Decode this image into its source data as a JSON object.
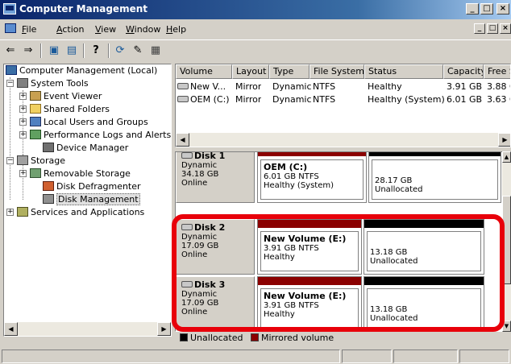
{
  "window": {
    "title": "Computer Management",
    "controls": [
      "_",
      "□",
      "×"
    ],
    "mdi_controls": [
      "_",
      "□",
      "×"
    ]
  },
  "menu": {
    "items": [
      {
        "label": "File",
        "ul": "F",
        "rest": "ile"
      },
      {
        "label": "Action",
        "ul": "A",
        "rest": "ction"
      },
      {
        "label": "View",
        "ul": "V",
        "rest": "iew"
      },
      {
        "label": "Window",
        "ul": "W",
        "rest": "indow"
      },
      {
        "label": "Help",
        "ul": "H",
        "rest": "elp"
      }
    ]
  },
  "toolbar": {
    "back": "⇐",
    "forward": "⇒",
    "up": "▣",
    "show_hide": "▤",
    "help": "?",
    "refresh": "⟳",
    "export": "✎",
    "properties": "▦"
  },
  "tree": {
    "items": [
      {
        "label": "Computer Management (Local)",
        "icon": "computer-icon"
      },
      {
        "label": "System Tools",
        "icon": "tools-icon"
      },
      {
        "label": "Event Viewer",
        "icon": "event-viewer-icon"
      },
      {
        "label": "Shared Folders",
        "icon": "folder-icon"
      },
      {
        "label": "Local Users and Groups",
        "icon": "users-icon"
      },
      {
        "label": "Performance Logs and Alerts",
        "icon": "performance-icon"
      },
      {
        "label": "Device Manager",
        "icon": "device-manager-icon"
      },
      {
        "label": "Storage",
        "icon": "storage-icon"
      },
      {
        "label": "Removable Storage",
        "icon": "removable-storage-icon"
      },
      {
        "label": "Disk Defragmenter",
        "icon": "defrag-icon"
      },
      {
        "label": "Disk Management",
        "icon": "disk-management-icon"
      },
      {
        "label": "Services and Applications",
        "icon": "services-icon"
      }
    ]
  },
  "volumes": {
    "columns": [
      "Volume",
      "Layout",
      "Type",
      "File System",
      "Status",
      "Capacity",
      "Free S"
    ],
    "rows": [
      [
        "New V...",
        "Mirror",
        "Dynamic",
        "NTFS",
        "Healthy",
        "3.91 GB",
        "3.88 G"
      ],
      [
        "OEM (C:)",
        "Mirror",
        "Dynamic",
        "NTFS",
        "Healthy (System)",
        "6.01 GB",
        "3.63 G"
      ]
    ]
  },
  "disks": [
    {
      "name": "Disk 1",
      "type": "Dynamic",
      "size": "34.18 GB",
      "state": "Online",
      "partitions": [
        {
          "name": "OEM  (C:)",
          "size": "6.01 GB NTFS",
          "status": "Healthy (System)",
          "kind": "mirrored"
        },
        {
          "name": "",
          "size": "28.17 GB",
          "status": "Unallocated",
          "kind": "unallocated"
        }
      ]
    },
    {
      "name": "Disk 2",
      "type": "Dynamic",
      "size": "17.09 GB",
      "state": "Online",
      "partitions": [
        {
          "name": "New Volume  (E:)",
          "size": "3.91 GB NTFS",
          "status": "Healthy",
          "kind": "mirrored"
        },
        {
          "name": "",
          "size": "13.18 GB",
          "status": "Unallocated",
          "kind": "unallocated"
        }
      ]
    },
    {
      "name": "Disk 3",
      "type": "Dynamic",
      "size": "17.09 GB",
      "state": "Online",
      "partitions": [
        {
          "name": "New Volume  (E:)",
          "size": "3.91 GB NTFS",
          "status": "Healthy",
          "kind": "mirrored"
        },
        {
          "name": "",
          "size": "13.18 GB",
          "status": "Unallocated",
          "kind": "unallocated"
        }
      ]
    }
  ],
  "legend": {
    "items": [
      {
        "label": "Unallocated",
        "color": "#000000"
      },
      {
        "label": "Mirrored volume",
        "color": "#8b0000"
      }
    ]
  },
  "colors": {
    "mirrored": "#8b0000",
    "unallocated": "#000000",
    "highlight": "#e8000a"
  }
}
